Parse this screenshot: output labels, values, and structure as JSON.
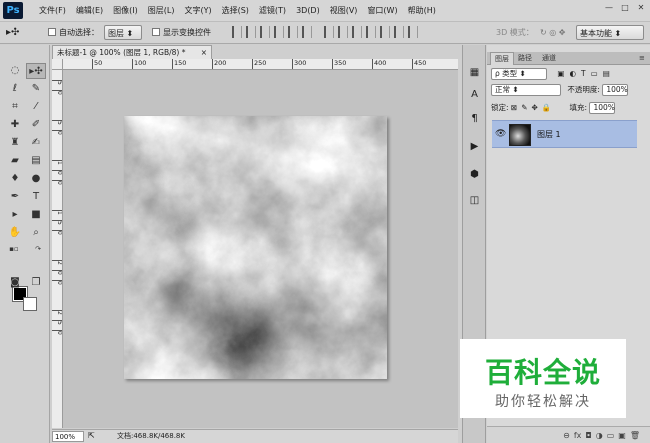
{
  "app": {
    "logo": "Ps"
  },
  "menubar": {
    "items": [
      "文件(F)",
      "编辑(E)",
      "图像(I)",
      "图层(L)",
      "文字(Y)",
      "选择(S)",
      "滤镜(T)",
      "3D(D)",
      "视图(V)",
      "窗口(W)",
      "帮助(H)"
    ],
    "window_controls": [
      "—",
      "□",
      "✕"
    ]
  },
  "options": {
    "tool_icon": "move-tool-icon",
    "auto_select_label": "自动选择：",
    "auto_select_value": "图层",
    "show_transform_label": "显示变换控件",
    "mode3d_label": "3D 模式：",
    "workspace_value": "基本功能"
  },
  "document": {
    "tab_title": "未标题-1 @ 100% (图层 1, RGB/8) *",
    "tab_close": "×",
    "ruler_h": [
      "50",
      "100",
      "150",
      "200",
      "250",
      "300",
      "350",
      "400",
      "450"
    ],
    "ruler_v": [
      "5",
      "0",
      "5",
      "0",
      "1",
      "0",
      "0",
      "1",
      "5",
      "0",
      "2",
      "0",
      "0",
      "2",
      "5",
      "0"
    ],
    "zoom": "100%",
    "doc_info": "文档:468.8K/468.8K"
  },
  "layers_panel": {
    "tabs": [
      "图层",
      "路径",
      "通道"
    ],
    "filter_label": "ρ 类型",
    "blend_mode": "正常",
    "opacity_label": "不透明度:",
    "opacity_value": "100%",
    "lock_label": "锁定:",
    "fill_label": "填充:",
    "fill_value": "100%",
    "layer_name": "图层 1",
    "bottom_icons": [
      "⊖",
      "fx",
      "◘",
      "◑",
      "▭",
      "▣",
      "🗑"
    ]
  },
  "watermark": {
    "title": "百科全说",
    "subtitle": "助你轻松解决"
  },
  "colors": {
    "accent": "#1fae3a",
    "selection": "#a8bde3"
  }
}
